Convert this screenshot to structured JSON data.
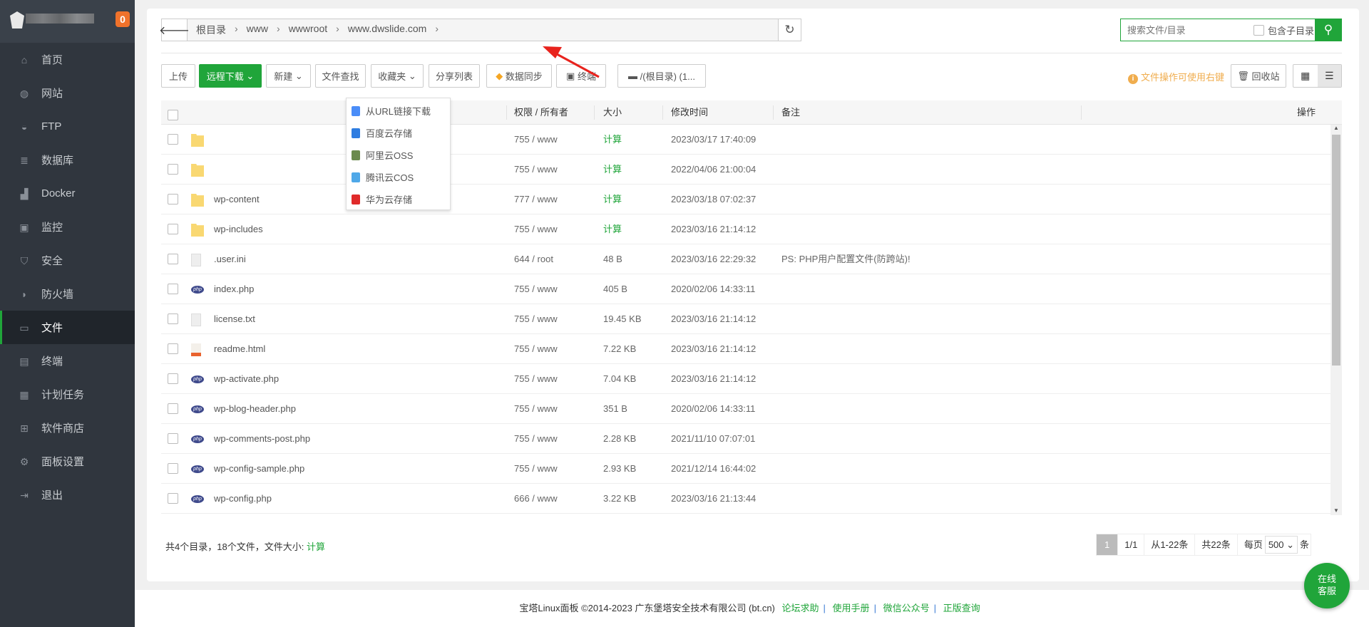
{
  "sidebar": {
    "badge": "0",
    "items": [
      {
        "label": "首页",
        "icon": "⌂"
      },
      {
        "label": "网站",
        "icon": "◍"
      },
      {
        "label": "FTP",
        "icon": "◒"
      },
      {
        "label": "数据库",
        "icon": "≣"
      },
      {
        "label": "Docker",
        "icon": "▟"
      },
      {
        "label": "监控",
        "icon": "▣"
      },
      {
        "label": "安全",
        "icon": "⛉"
      },
      {
        "label": "防火墙",
        "icon": "◗"
      },
      {
        "label": "文件",
        "icon": "▭",
        "active": true
      },
      {
        "label": "终端",
        "icon": "▤"
      },
      {
        "label": "计划任务",
        "icon": "▦"
      },
      {
        "label": "软件商店",
        "icon": "⊞"
      },
      {
        "label": "面板设置",
        "icon": "⚙"
      },
      {
        "label": "退出",
        "icon": "⇥"
      }
    ]
  },
  "breadcrumb": [
    "根目录",
    "www",
    "wwwroot",
    "www.dwslide.com"
  ],
  "search": {
    "placeholder": "搜索文件/目录",
    "include_sub": "包含子目录"
  },
  "toolbar": {
    "upload": "上传",
    "remote_download": "远程下载",
    "new": "新建",
    "find": "文件查找",
    "favorites": "收藏夹",
    "share_list": "分享列表",
    "data_sync": "数据同步",
    "terminal": "终端",
    "disk": "/(根目录) (1...",
    "tip": "文件操作可使用右键",
    "recycle": "回收站"
  },
  "remote_menu": [
    {
      "label": "从URL链接下载",
      "color": "#4a8df8"
    },
    {
      "label": "百度云存储",
      "color": "#2f7de1"
    },
    {
      "label": "阿里云OSS",
      "color": "#6b8a4e"
    },
    {
      "label": "腾讯云COS",
      "color": "#4fa8e8"
    },
    {
      "label": "华为云存储",
      "color": "#e02a2a"
    }
  ],
  "columns": {
    "perm": "权限 / 所有者",
    "size": "大小",
    "mtime": "修改时间",
    "note": "备注",
    "ops": "操作"
  },
  "files": [
    {
      "name": "",
      "type": "folder",
      "perm": "755 / www",
      "size": "计算",
      "mtime": "2023/03/17 17:40:09",
      "note": ""
    },
    {
      "name": "",
      "type": "folder",
      "perm": "755 / www",
      "size": "计算",
      "mtime": "2022/04/06 21:00:04",
      "note": ""
    },
    {
      "name": "wp-content",
      "type": "folder",
      "perm": "777 / www",
      "size": "计算",
      "mtime": "2023/03/18 07:02:37",
      "note": ""
    },
    {
      "name": "wp-includes",
      "type": "folder",
      "perm": "755 / www",
      "size": "计算",
      "mtime": "2023/03/16 21:14:12",
      "note": ""
    },
    {
      "name": ".user.ini",
      "type": "text",
      "perm": "644 / root",
      "size": "48 B",
      "mtime": "2023/03/16 22:29:32",
      "note": "PS: PHP用户配置文件(防跨站)!"
    },
    {
      "name": "index.php",
      "type": "php",
      "perm": "755 / www",
      "size": "405 B",
      "mtime": "2020/02/06 14:33:11",
      "note": ""
    },
    {
      "name": "license.txt",
      "type": "text",
      "perm": "755 / www",
      "size": "19.45 KB",
      "mtime": "2023/03/16 21:14:12",
      "note": ""
    },
    {
      "name": "readme.html",
      "type": "html",
      "perm": "755 / www",
      "size": "7.22 KB",
      "mtime": "2023/03/16 21:14:12",
      "note": ""
    },
    {
      "name": "wp-activate.php",
      "type": "php",
      "perm": "755 / www",
      "size": "7.04 KB",
      "mtime": "2023/03/16 21:14:12",
      "note": ""
    },
    {
      "name": "wp-blog-header.php",
      "type": "php",
      "perm": "755 / www",
      "size": "351 B",
      "mtime": "2020/02/06 14:33:11",
      "note": ""
    },
    {
      "name": "wp-comments-post.php",
      "type": "php",
      "perm": "755 / www",
      "size": "2.28 KB",
      "mtime": "2021/11/10 07:07:01",
      "note": ""
    },
    {
      "name": "wp-config-sample.php",
      "type": "php",
      "perm": "755 / www",
      "size": "2.93 KB",
      "mtime": "2021/12/14 16:44:02",
      "note": ""
    },
    {
      "name": "wp-config.php",
      "type": "php",
      "perm": "666 / www",
      "size": "3.22 KB",
      "mtime": "2023/03/16 21:13:44",
      "note": ""
    }
  ],
  "summary": {
    "text": "共4个目录，18个文件，文件大小:",
    "calc": "计算"
  },
  "pager": {
    "current": "1",
    "pages": "1/1",
    "range": "从1-22条",
    "total": "共22条",
    "per_page_label": "每页",
    "per_page": "500",
    "unit": "条"
  },
  "footer": {
    "copyright": "宝塔Linux面板 ©2014-2023 广东堡塔安全技术有限公司 (bt.cn)",
    "links": [
      "论坛求助",
      "使用手册",
      "微信公众号",
      "正版查询"
    ]
  },
  "chat": {
    "line1": "在线",
    "line2": "客服"
  },
  "colors": {
    "accent": "#20a53a",
    "warning": "#f0ad4e",
    "badge": "#f0722b",
    "annotation_arrow": "#e8231d"
  }
}
